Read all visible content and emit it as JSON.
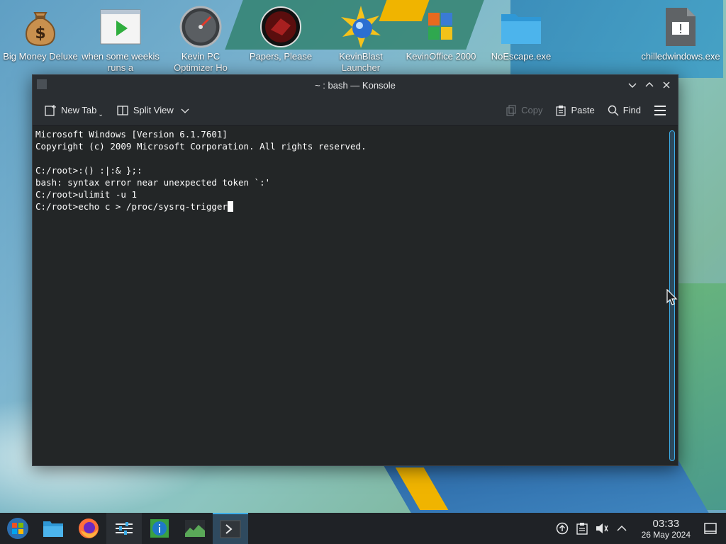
{
  "desktop": {
    "icons": [
      {
        "label": "Big Money Deluxe",
        "icon": "money-bag-icon"
      },
      {
        "label": "when some weekis runs a",
        "icon": "video-play-icon"
      },
      {
        "label": "Kevin PC Optimizer Ho",
        "icon": "speedometer-icon"
      },
      {
        "label": "Papers, Please",
        "icon": "papers-please-icon"
      },
      {
        "label": "KevinBlast Launcher",
        "icon": "kevinblast-icon"
      },
      {
        "label": "KevinOffice 2000",
        "icon": "office-icon"
      },
      {
        "label": "NoEscape.exe",
        "icon": "folder-icon"
      },
      {
        "label": "chilledwindows.exe",
        "icon": "exe-file-icon"
      }
    ]
  },
  "window": {
    "title": "~ : bash — Konsole",
    "toolbar": {
      "new_tab": "New Tab",
      "split_view": "Split View",
      "copy": "Copy",
      "paste": "Paste",
      "find": "Find"
    },
    "terminal": {
      "lines": [
        "Microsoft Windows [Version 6.1.7601]",
        "Copyright (c) 2009 Microsoft Corporation. All rights reserved.",
        "",
        "C:/root>:() :|:& };:",
        "bash: syntax error near unexpected token `:'",
        "C:/root>ulimit -u 1",
        "C:/root>echo c > /proc/sysrq-trigger"
      ]
    }
  },
  "taskbar": {
    "apps": [
      "start-menu-icon",
      "file-manager-icon",
      "firefox-icon",
      "settings-icon",
      "system-info-icon",
      "system-monitor-icon",
      "konsole-icon"
    ],
    "clock": {
      "time": "03:33",
      "date": "26 May 2024"
    }
  },
  "colors": {
    "accent": "#3daee9",
    "window_bg": "#232629",
    "terminal_bg": "#232627",
    "terminal_fg": "#fcfcfc",
    "taskbar_bg": "#1f2226"
  }
}
